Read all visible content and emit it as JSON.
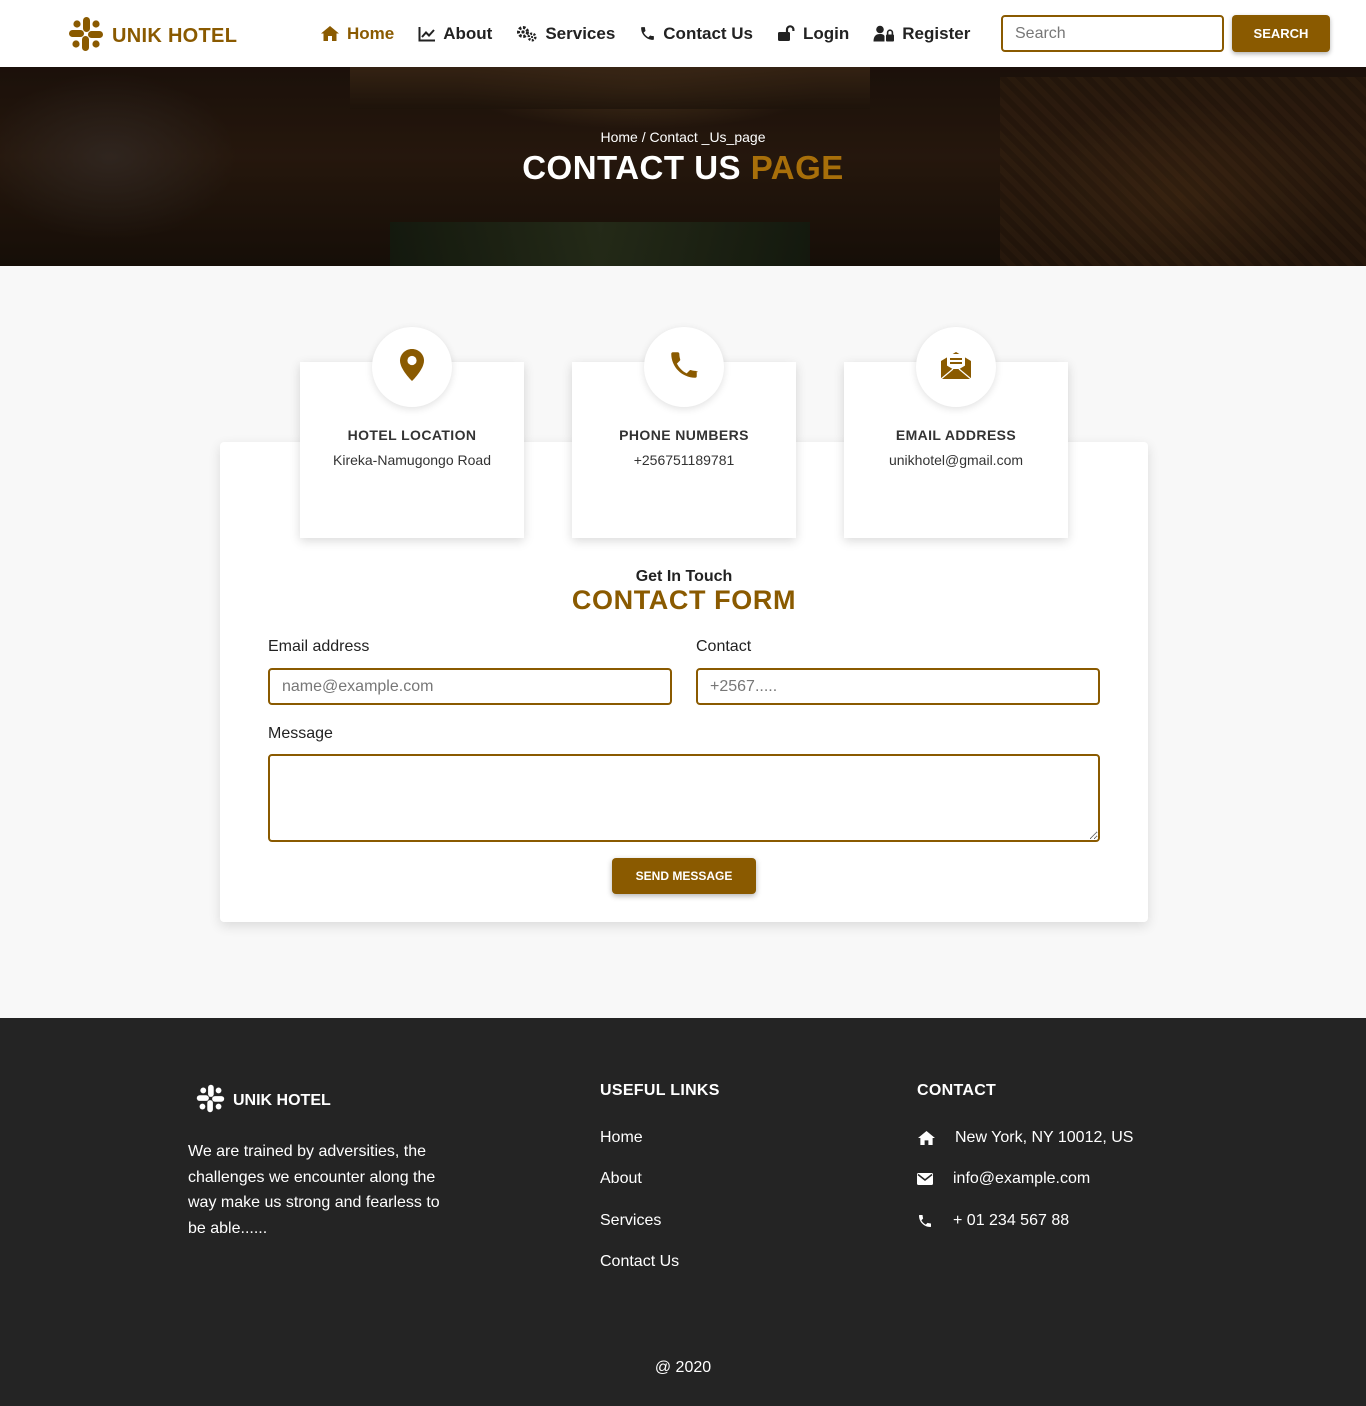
{
  "colors": {
    "accent": "#8a5a00",
    "footer_bg": "#242424",
    "page_bg": "#f8f8f8"
  },
  "brand": {
    "name": "UNIK HOTEL",
    "icon": "slack-hash-icon"
  },
  "nav": {
    "items": [
      {
        "label": "Home",
        "icon": "home-icon",
        "active": true
      },
      {
        "label": "About",
        "icon": "chart-line-icon"
      },
      {
        "label": "Services",
        "icon": "cogs-icon"
      },
      {
        "label": "Contact Us",
        "icon": "phone-icon"
      },
      {
        "label": "Login",
        "icon": "unlock-icon"
      },
      {
        "label": "Register",
        "icon": "user-lock-icon"
      }
    ]
  },
  "search": {
    "placeholder": "Search",
    "button_label": "SEARCH"
  },
  "hero": {
    "breadcrumb": "Home / Contact _Us_page",
    "title_main": "CONTACT US",
    "title_accent": "PAGE"
  },
  "info_boxes": [
    {
      "title": "HOTEL LOCATION",
      "value": "Kireka-Namugongo Road",
      "icon": "map-marker-icon"
    },
    {
      "title": "PHONE NUMBERS",
      "value": "+256751189781",
      "icon": "phone-icon"
    },
    {
      "title": "EMAIL ADDRESS",
      "value": "unikhotel@gmail.com",
      "icon": "envelope-open-text-icon"
    }
  ],
  "form": {
    "eyebrow": "Get In Touch",
    "title": "CONTACT FORM",
    "email_label": "Email address",
    "email_placeholder": "name@example.com",
    "contact_label": "Contact",
    "contact_placeholder": "+2567.....",
    "message_label": "Message",
    "message_value": "",
    "submit_label": "SEND MESSAGE"
  },
  "footer": {
    "brand": "UNIK HOTEL",
    "description": "We are trained by adversities, the challenges we encounter along the way make us strong and fearless to be able......",
    "links_heading": "USEFUL LINKS",
    "links": [
      "Home",
      "About",
      "Services",
      "Contact Us"
    ],
    "contact_heading": "CONTACT",
    "contact": [
      {
        "icon": "home-icon",
        "text": "New York, NY 10012, US"
      },
      {
        "icon": "envelope-icon",
        "text": "info@example.com"
      },
      {
        "icon": "phone-icon",
        "text": "+ 01 234 567 88"
      }
    ],
    "copyright": "@ 2020"
  }
}
